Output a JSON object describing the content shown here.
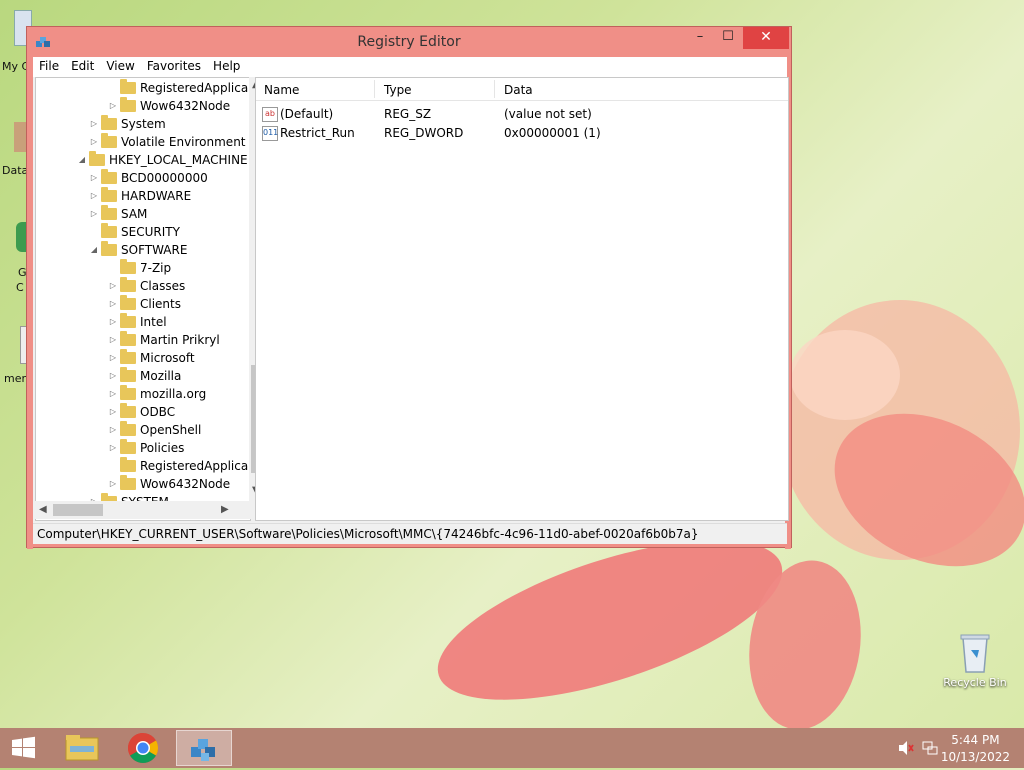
{
  "window": {
    "title": "Registry Editor",
    "min_label": "–",
    "max_label": "☐",
    "close_label": "✕"
  },
  "menu": [
    "File",
    "Edit",
    "View",
    "Favorites",
    "Help"
  ],
  "tree": [
    {
      "label": "RegisteredApplica",
      "level": 2,
      "expander": "none"
    },
    {
      "label": "Wow6432Node",
      "level": 2,
      "expander": "collapsed"
    },
    {
      "label": "System",
      "level": 1,
      "expander": "collapsed"
    },
    {
      "label": "Volatile Environment",
      "level": 1,
      "expander": "collapsed"
    },
    {
      "label": "HKEY_LOCAL_MACHINE",
      "level": 0,
      "expander": "expanded"
    },
    {
      "label": "BCD00000000",
      "level": 1,
      "expander": "collapsed"
    },
    {
      "label": "HARDWARE",
      "level": 1,
      "expander": "collapsed"
    },
    {
      "label": "SAM",
      "level": 1,
      "expander": "collapsed"
    },
    {
      "label": "SECURITY",
      "level": 1,
      "expander": "none"
    },
    {
      "label": "SOFTWARE",
      "level": 1,
      "expander": "expanded"
    },
    {
      "label": "7-Zip",
      "level": 2,
      "expander": "none"
    },
    {
      "label": "Classes",
      "level": 2,
      "expander": "collapsed"
    },
    {
      "label": "Clients",
      "level": 2,
      "expander": "collapsed"
    },
    {
      "label": "Intel",
      "level": 2,
      "expander": "collapsed"
    },
    {
      "label": "Martin Prikryl",
      "level": 2,
      "expander": "collapsed"
    },
    {
      "label": "Microsoft",
      "level": 2,
      "expander": "collapsed"
    },
    {
      "label": "Mozilla",
      "level": 2,
      "expander": "collapsed"
    },
    {
      "label": "mozilla.org",
      "level": 2,
      "expander": "collapsed"
    },
    {
      "label": "ODBC",
      "level": 2,
      "expander": "collapsed"
    },
    {
      "label": "OpenShell",
      "level": 2,
      "expander": "collapsed"
    },
    {
      "label": "Policies",
      "level": 2,
      "expander": "collapsed"
    },
    {
      "label": "RegisteredApplica",
      "level": 2,
      "expander": "none"
    },
    {
      "label": "Wow6432Node",
      "level": 2,
      "expander": "collapsed"
    },
    {
      "label": "SYSTEM",
      "level": 1,
      "expander": "collapsed"
    }
  ],
  "list": {
    "headers": [
      "Name",
      "Type",
      "Data"
    ],
    "rows": [
      {
        "icon": "ab",
        "name": "(Default)",
        "type": "REG_SZ",
        "data": "(value not set)"
      },
      {
        "icon": "011",
        "name": "Restrict_Run",
        "type": "REG_DWORD",
        "data": "0x00000001 (1)"
      }
    ]
  },
  "statusbar": {
    "path": "Computer\\HKEY_CURRENT_USER\\Software\\Policies\\Microsoft\\MMC\\{74246bfc-4c96-11d0-abef-0020af6b0b7a}"
  },
  "desktop": {
    "icons": [
      {
        "label": "Recycle Bin",
        "icon": "recycle-bin-icon"
      }
    ],
    "left_clipped": [
      "My C",
      "Data",
      "G",
      "C",
      "mer"
    ]
  },
  "taskbar": {
    "items": [
      "start-icon",
      "file-explorer-icon",
      "chrome-icon",
      "registry-editor-icon"
    ],
    "time": "5:44 PM",
    "date": "10/13/2022"
  },
  "colors": {
    "titlebar": "#f08f87",
    "close_button": "#e04343",
    "taskbar": "#b48272",
    "folder": "#e8c65a"
  }
}
